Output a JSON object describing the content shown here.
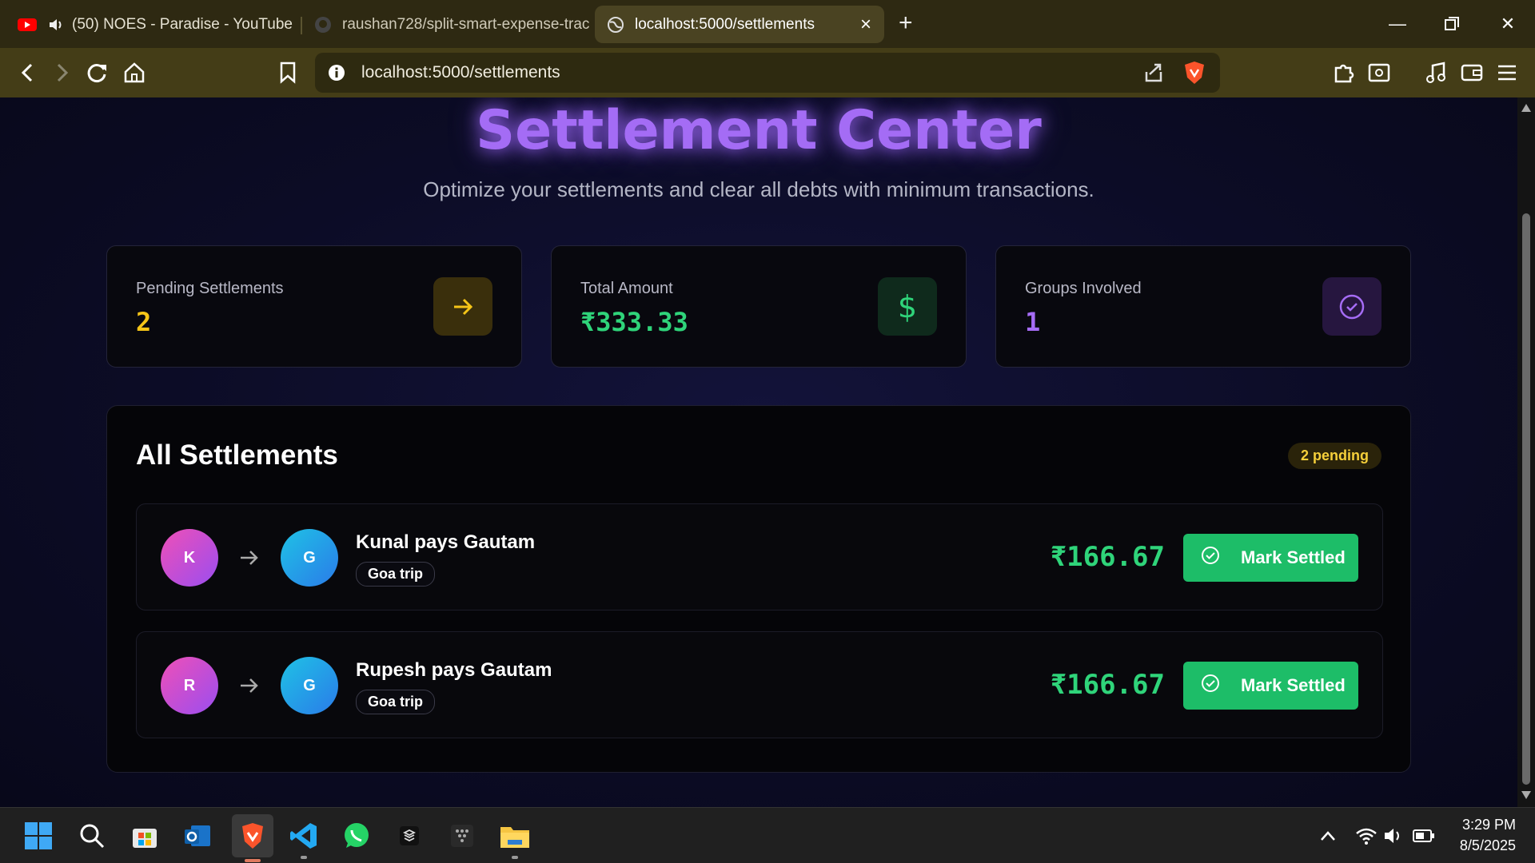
{
  "browser": {
    "tabs": [
      {
        "label": "(50) NOES - Paradise - YouTube",
        "icon": "youtube-icon"
      },
      {
        "label": "raushan728/split-smart-expense-trac",
        "icon": "github-icon"
      },
      {
        "label": "localhost:5000/settlements",
        "icon": "globe-icon"
      }
    ],
    "url": "localhost:5000/settlements"
  },
  "page": {
    "title": "Settlement Center",
    "subtitle": "Optimize your settlements and clear all debts with minimum transactions.",
    "stats": [
      {
        "label": "Pending Settlements",
        "value": "2",
        "color": "#f5c518",
        "icon": "arrow-right-icon"
      },
      {
        "label": "Total Amount",
        "value": "₹333.33",
        "color": "#2fd47a",
        "icon": "dollar-icon"
      },
      {
        "label": "Groups Involved",
        "value": "1",
        "color": "#a56cf5",
        "icon": "check-circle-icon"
      }
    ],
    "settlements_title": "All Settlements",
    "pending_badge": "2 pending",
    "settlements": [
      {
        "from_initial": "K",
        "to_initial": "G",
        "title": "Kunal pays Gautam",
        "group": "Goa trip",
        "amount": "₹166.67",
        "action": "Mark Settled"
      },
      {
        "from_initial": "R",
        "to_initial": "G",
        "title": "Rupesh pays Gautam",
        "group": "Goa trip",
        "amount": "₹166.67",
        "action": "Mark Settled"
      }
    ]
  },
  "taskbar": {
    "time": "3:29 PM",
    "date": "8/5/2025"
  },
  "colors": {
    "accent_purple": "#a46cf5",
    "success_green": "#1dbd68",
    "warning_yellow": "#f5cf3a"
  }
}
